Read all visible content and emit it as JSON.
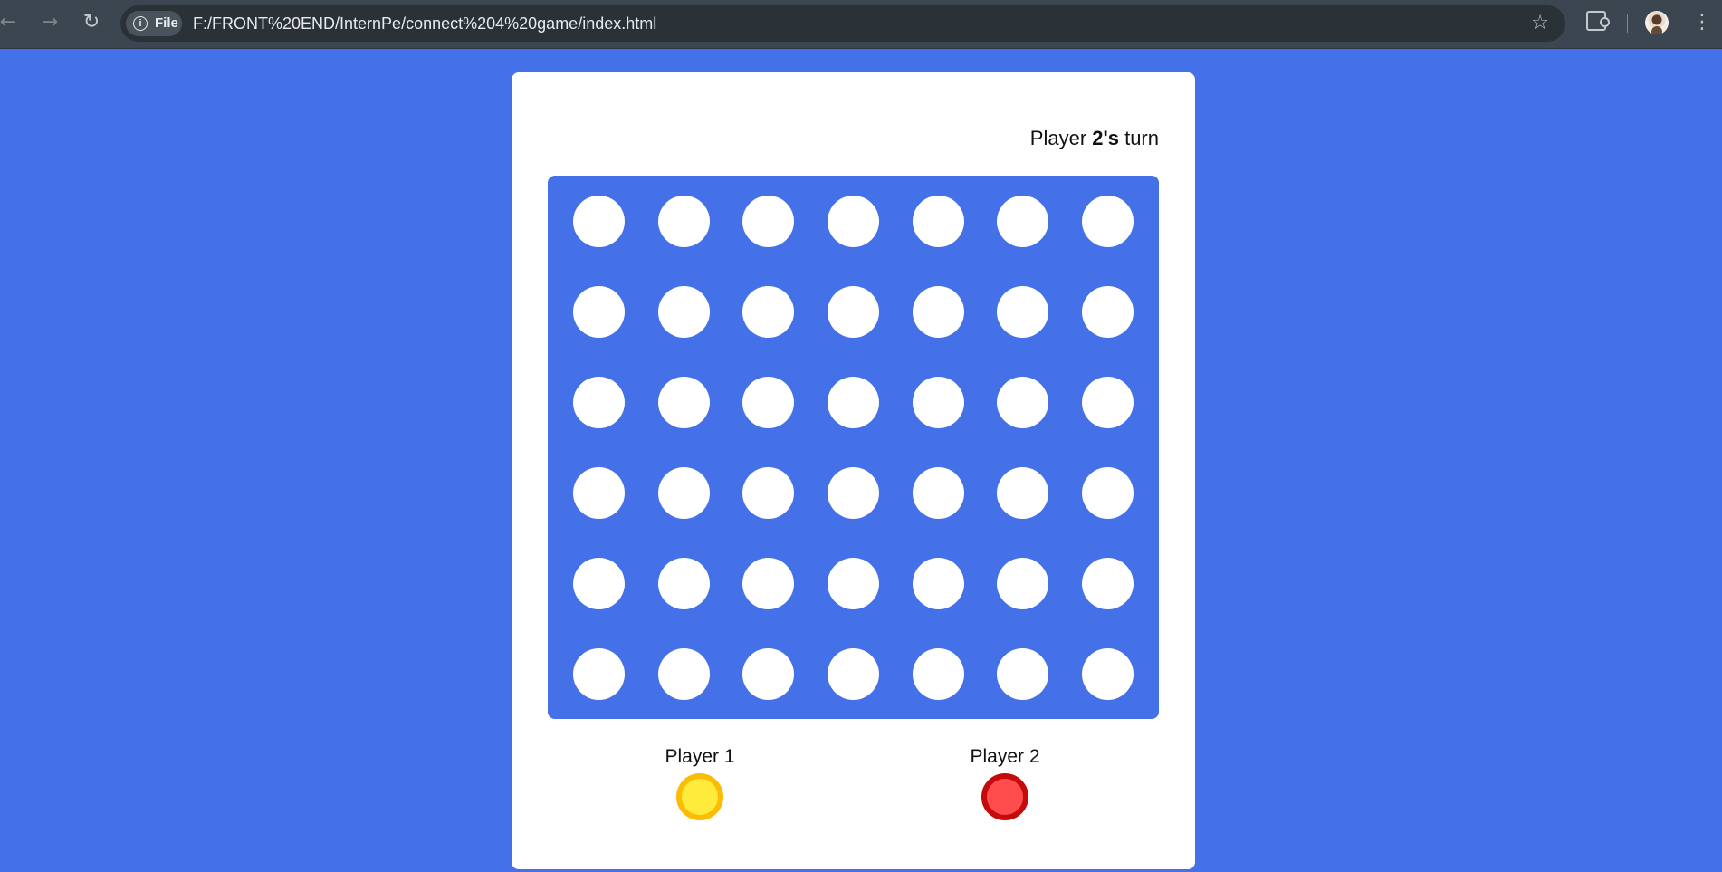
{
  "browser": {
    "back_icon": "←",
    "forward_icon": "→",
    "reload_icon": "↻",
    "site_chip_label": "File",
    "info_icon": "i",
    "url": "F:/FRONT%20END/InternPe/connect%204%20game/index.html",
    "star_icon": "☆",
    "menu_icon": "⋮"
  },
  "game": {
    "turn_prefix": "Player ",
    "turn_player": "2's",
    "turn_suffix": " turn",
    "rows": 6,
    "columns": 7,
    "players": [
      {
        "label": "Player 1",
        "color": "yellow"
      },
      {
        "label": "Player 2",
        "color": "red"
      }
    ]
  },
  "colors": {
    "background": "#4470e8",
    "board": "#4470e8",
    "hole": "#ffffff",
    "player1_fill": "#ffeb3b",
    "player1_rim": "#fbbc04",
    "player2_fill": "#ff4d4d",
    "player2_rim": "#c40a0a"
  }
}
